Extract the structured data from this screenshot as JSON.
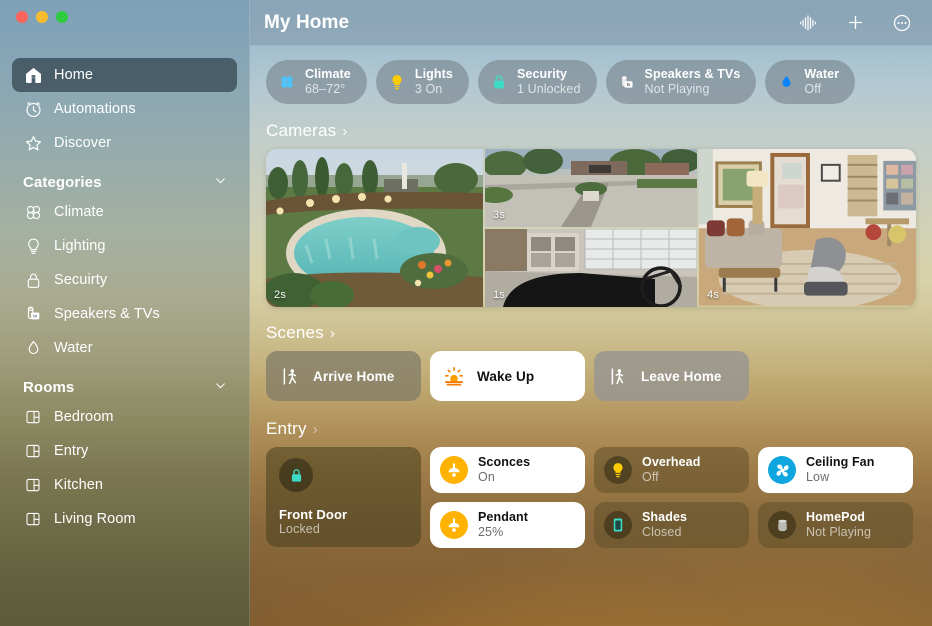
{
  "window": {
    "traffic_lights": [
      "close",
      "minimize",
      "zoom"
    ],
    "title": "My Home"
  },
  "toolbar": {
    "siri_label": "siri-waveform",
    "add_label": "add",
    "more_label": "more"
  },
  "sidebar": {
    "top_items": [
      {
        "label": "Home",
        "icon": "home-icon",
        "selected": true
      },
      {
        "label": "Automations",
        "icon": "automations-icon",
        "selected": false
      },
      {
        "label": "Discover",
        "icon": "discover-star-icon",
        "selected": false
      }
    ],
    "categories": {
      "header": "Categories",
      "items": [
        {
          "label": "Climate",
          "icon": "fan-icon"
        },
        {
          "label": "Lighting",
          "icon": "bulb-icon"
        },
        {
          "label": "Secuirty",
          "icon": "lock-icon"
        },
        {
          "label": "Speakers & TVs",
          "icon": "speaker-tv-icon"
        },
        {
          "label": "Water",
          "icon": "water-drop-icon"
        }
      ]
    },
    "rooms": {
      "header": "Rooms",
      "items": [
        {
          "label": "Bedroom",
          "icon": "room-icon"
        },
        {
          "label": "Entry",
          "icon": "room-icon"
        },
        {
          "label": "Kitchen",
          "icon": "room-icon"
        },
        {
          "label": "Living Room",
          "icon": "room-icon"
        }
      ]
    }
  },
  "status_chips": [
    {
      "title": "Climate",
      "status": "68–72°",
      "icon": "fan-icon",
      "color": "#4fc3f7"
    },
    {
      "title": "Lights",
      "status": "3 On",
      "icon": "bulb-icon",
      "color": "#ffcc00"
    },
    {
      "title": "Security",
      "status": "1 Unlocked",
      "icon": "lock-icon",
      "color": "#3ddbc6"
    },
    {
      "title": "Speakers & TVs",
      "status": "Not Playing",
      "icon": "speaker-tv-icon",
      "color": "#e8e8e8"
    },
    {
      "title": "Water",
      "status": "Off",
      "icon": "water-drop-icon",
      "color": "#0a84ff"
    }
  ],
  "sections": {
    "cameras": {
      "header": "Cameras",
      "arrow": "›"
    },
    "scenes": {
      "header": "Scenes",
      "arrow": "›"
    },
    "entry": {
      "header": "Entry",
      "arrow": "›"
    }
  },
  "cameras": [
    {
      "name": "pool-camera",
      "stamp": "2s"
    },
    {
      "name": "driveway-camera",
      "stamp": "3s"
    },
    {
      "name": "garage-camera",
      "stamp": "1s"
    },
    {
      "name": "living-room-camera",
      "stamp": "4s"
    }
  ],
  "scenes": [
    {
      "label": "Arrive Home",
      "icon": "person-arrive-icon",
      "state": "olive"
    },
    {
      "label": "Wake Up",
      "icon": "sunrise-icon",
      "state": "active"
    },
    {
      "label": "Leave Home",
      "icon": "person-leave-icon",
      "state": "gray"
    }
  ],
  "entry_accessories": {
    "lock": {
      "name": "Front Door",
      "state": "Locked",
      "icon": "lock-icon",
      "color": "#3ddbc6"
    },
    "column_one": [
      {
        "name": "Sconces",
        "state": "On",
        "icon": "sconce-light-icon",
        "active": true,
        "color": "#ffb300"
      },
      {
        "name": "Pendant",
        "state": "25%",
        "icon": "pendant-light-icon",
        "active": true,
        "color": "#ffb300"
      }
    ],
    "column_two": [
      {
        "name": "Overhead",
        "state": "Off",
        "icon": "bulb-icon",
        "active": false,
        "color": "#ffcc00"
      },
      {
        "name": "Shades",
        "state": "Closed",
        "icon": "shades-icon",
        "active": false,
        "color": "#3ddbc6"
      }
    ],
    "column_three": [
      {
        "name": "Ceiling Fan",
        "state": "Low",
        "icon": "ceiling-fan-icon",
        "active": true,
        "color": "#0fa6e0"
      },
      {
        "name": "HomePod",
        "state": "Not Playing",
        "icon": "homepod-icon",
        "active": false,
        "color": "#b9b9b4"
      }
    ]
  }
}
